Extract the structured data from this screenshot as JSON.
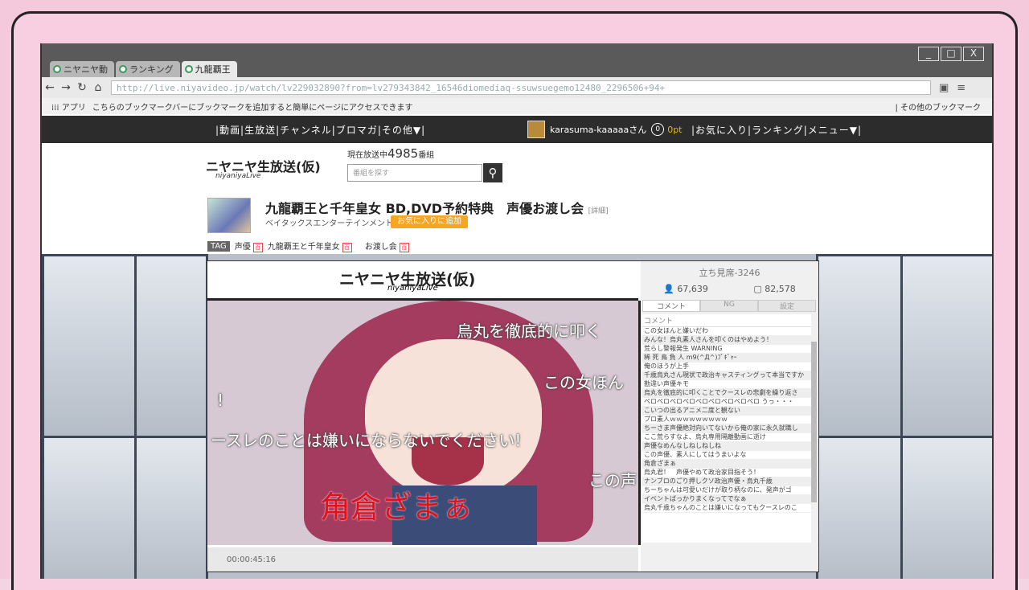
{
  "window": {
    "min": "_",
    "max": "□",
    "close": "X"
  },
  "tabs": [
    {
      "label": "ニヤニヤ動"
    },
    {
      "label": "ランキング"
    },
    {
      "label": "九龍覇王"
    }
  ],
  "address": {
    "url": "http://live.niyavideo.jp/watch/lv229032890?from=lv279343842_16546diomediaq-ssuwsuegemo12480_2296506+94+"
  },
  "bookmarks": {
    "apps": "アプリ",
    "hint": "こちらのブックマークバーにブックマークを追加すると簡単にページにアクセスできます",
    "other": "その他のブックマーク"
  },
  "sitenav": {
    "menu": "|動画|生放送|チャンネル|ブロマガ|その他▼|",
    "username": "karasuma-kaaaaaさん",
    "points_icon": "0",
    "points": "0pt",
    "right": "|お気に入り|ランキング|メニュー▼|"
  },
  "header": {
    "logo": "ニヤニヤ生放送(仮)",
    "logo_sub": "niyaniyaLive",
    "on_air_prefix": "現在放送中",
    "on_air_count": "4985",
    "on_air_suffix": "番組",
    "search_placeholder": "番組を探す"
  },
  "program": {
    "title": "九龍覇王と千年皇女 BD,DVD予約特典　声優お渡し会",
    "detail": "[詳細]",
    "company": "ベイタックスエンターテインメント",
    "fav_button": "お気に入りに追加"
  },
  "tags": {
    "badge": "TAG",
    "items": [
      "声優",
      "九龍覇王と千年皇女",
      "お渡し会"
    ]
  },
  "player": {
    "logo": "ニヤニヤ生放送(仮)",
    "logo_sub": "niyaniyaLive",
    "time": "00:00:45:16",
    "danmaku": [
      "烏丸を徹底的に叩く",
      "この女ほん",
      "!",
      "ースレのことは嫌いにならないでください!",
      "この声",
      "角倉ざまぁ"
    ]
  },
  "side": {
    "seat": "立ち見席-3246",
    "viewers": "67,639",
    "comments": "82,578",
    "tabs": [
      "コメント",
      "NG",
      "設定"
    ],
    "list_header": "コメント",
    "rows": [
      "この女ほんと嫌いだわ",
      "みんな！烏丸素人さんを叩くのはやめよう！",
      "荒らし警報発生 WARNING",
      "稀 死 鳥 負 人 m9(^Д^)ﾌﾟｷﾞｬｰ",
      "俺のほうが上手",
      "千歳烏丸さん現状で政治キャスティングって本当ですか",
      "勘違い声優キモ",
      "烏丸を徹底的に叩くことでクースレの悲劇を繰り返さ",
      "ペロペロペロペロペロペロペロペロペロ うっ・・・",
      "こいつの出るアニメ二度と観ない",
      "プロ素人ｗｗｗｗｗｗｗｗｗ",
      "ちーさま声優絶対向いてないから俺の家に永久就職し",
      "ここ荒らすなよ、烏丸専用隔離動画に逝け",
      "声優なめんなしねしねしね",
      "この声優、素人にしてはうまいよな",
      "角倉ざまぁ",
      "烏丸君！　声優やめて政治家目指そう！",
      "ナンブロのごり押しクソ政治声優・烏丸千歳",
      "ちーちゃんは可愛いだけが取り柄なのに、発声がゴ",
      "イベントばっかりまくなってでなぁ",
      "烏丸千歳ちゃんのことは嫌いになってもクースレのこ"
    ]
  }
}
